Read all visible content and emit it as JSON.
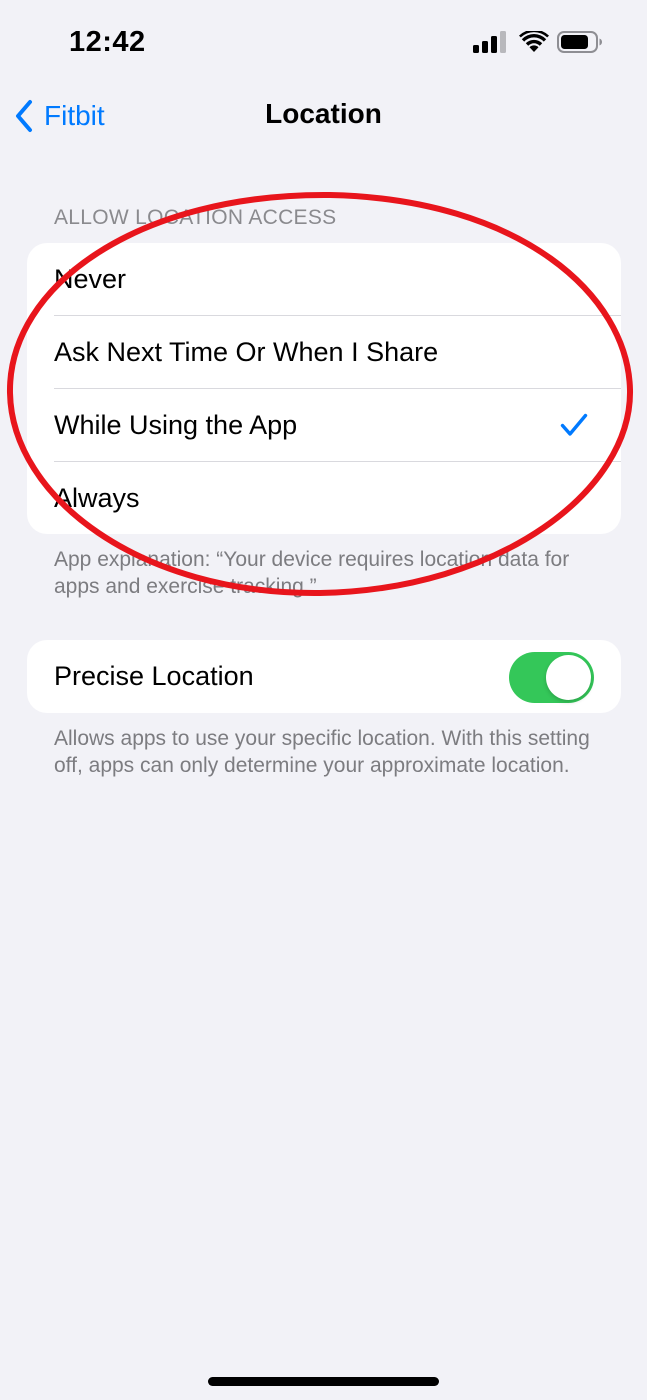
{
  "status_bar": {
    "time": "12:42"
  },
  "nav": {
    "back_label": "Fitbit",
    "title": "Location"
  },
  "location_access": {
    "header": "ALLOW LOCATION ACCESS",
    "options": [
      {
        "label": "Never",
        "selected": false
      },
      {
        "label": "Ask Next Time Or When I Share",
        "selected": false
      },
      {
        "label": "While Using the App",
        "selected": true
      },
      {
        "label": "Always",
        "selected": false
      }
    ],
    "footer": "App explanation: “Your device requires location data for apps and exercise tracking.”"
  },
  "precise_location": {
    "label": "Precise Location",
    "enabled": true,
    "footer": "Allows apps to use your specific location. With this setting off, apps can only determine your approximate location."
  },
  "colors": {
    "accent": "#007aff",
    "toggle_on": "#34c759",
    "annotation": "#e8151c",
    "background": "#f2f2f7"
  }
}
